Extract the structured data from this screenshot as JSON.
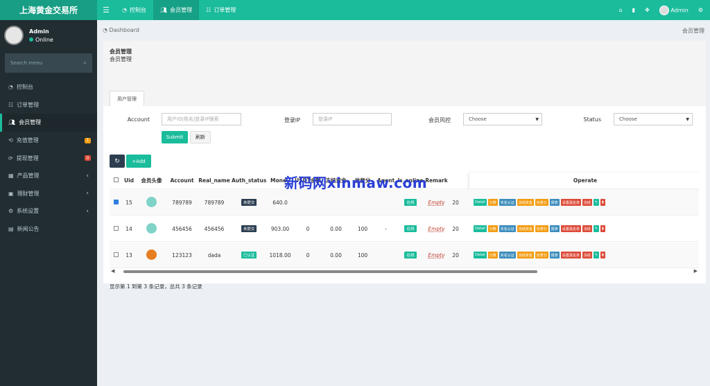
{
  "app": {
    "title": "上海黄金交易所"
  },
  "topbar": {
    "nav": [
      {
        "label": "控制台"
      },
      {
        "label": "会员管理"
      },
      {
        "label": "订单管理"
      }
    ],
    "user": "Admin"
  },
  "sidebar": {
    "user": {
      "name": "Admin",
      "status": "Online"
    },
    "search_placeholder": "Search menu",
    "items": [
      {
        "label": "控制台"
      },
      {
        "label": "订单管理"
      },
      {
        "label": "会员管理"
      },
      {
        "label": "充值管理",
        "badge": "1"
      },
      {
        "label": "提现管理",
        "badge": "0"
      },
      {
        "label": "产品管理"
      },
      {
        "label": "理财管理"
      },
      {
        "label": "系统设置"
      },
      {
        "label": "新闻公告"
      }
    ]
  },
  "breadcrumb": {
    "left": "Dashboard",
    "right": "会员管理"
  },
  "panel": {
    "title": "会员管理",
    "subtitle": "会员管理",
    "tab": "用户管理"
  },
  "filters": {
    "account_label": "Account",
    "account_placeholder": "用户ID|姓名|登录IP搜索",
    "ip_label": "登录IP",
    "ip_placeholder": "登录IP",
    "risk_label": "会员风控",
    "risk_value": "Choose",
    "status_label": "Status",
    "status_value": "Choose",
    "submit": "Submit",
    "reset": "刷新"
  },
  "toolbar": {
    "add": "Add"
  },
  "table": {
    "headers": [
      "Uid",
      "会员头像",
      "Account",
      "Real_name",
      "Auth_status",
      "Money",
      "USDT余额",
      "冻结资金",
      "信誉分",
      "Agent",
      "Is_online",
      "Remark",
      "Operate"
    ],
    "rows": [
      {
        "uid": "15",
        "account": "789789",
        "real_name": "789789",
        "auth": "未提交",
        "money": "640.0",
        "usdt": "",
        "frozen": "",
        "credit": "",
        "agent": "",
        "online": "在线",
        "remark": "Empty",
        "extra": "20",
        "checked": true
      },
      {
        "uid": "14",
        "account": "456456",
        "real_name": "456456",
        "auth": "未提交",
        "money": "903.00",
        "usdt": "0",
        "frozen": "0.00",
        "credit": "100",
        "agent": "-",
        "online": "在线",
        "remark": "Empty",
        "extra": "20",
        "checked": false
      },
      {
        "uid": "13",
        "account": "123123",
        "real_name": "dada",
        "auth": "已认证",
        "money": "1018.00",
        "usdt": "0",
        "frozen": "0.00",
        "credit": "100",
        "agent": "",
        "online": "在线",
        "remark": "Empty",
        "extra": "20",
        "checked": false
      }
    ],
    "ops": [
      "Detail",
      "分数",
      "实名认证",
      "冻结资金",
      "信誉分",
      "报表",
      "设置黑名单",
      "冻结"
    ]
  },
  "footer": "显示第 1 到第 3 条记录，总共 3 条记录",
  "watermark": "新码网xinmaw.com",
  "colors": {
    "accent": "#1abc9c",
    "sidebar": "#222d32",
    "info": "#3c8dbc",
    "warning": "#f39c12",
    "danger": "#dd4b39"
  }
}
